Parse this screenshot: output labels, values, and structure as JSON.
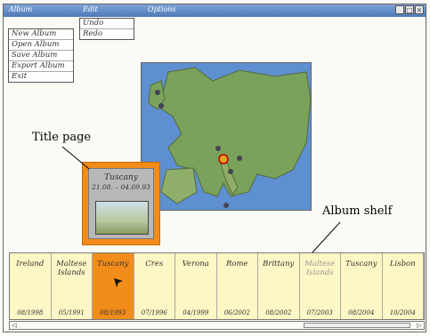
{
  "menu": {
    "album": "Album",
    "edit": "Edit",
    "options": "Options"
  },
  "window_buttons": [
    "_",
    "□",
    "×"
  ],
  "album_menu_items": [
    "New Album",
    "Open Album",
    "Save Album",
    "Export Album",
    "Exit"
  ],
  "edit_menu_items": [
    "Undo",
    "Redo"
  ],
  "title_page": {
    "title": "Tuscany",
    "dates": "21.08. – 04.09.93"
  },
  "callouts": {
    "title_page": "Title page",
    "album_shelf": "Album shelf"
  },
  "albums": [
    {
      "name": "Ireland",
      "date": "08/1998"
    },
    {
      "name": "Maltese Islands",
      "date": "05/1991"
    },
    {
      "name": "Tuscany",
      "date": "08/1993"
    },
    {
      "name": "Cres",
      "date": "07/1996"
    },
    {
      "name": "Verona",
      "date": "04/1999"
    },
    {
      "name": "Rome",
      "date": "06/2002"
    },
    {
      "name": "Brittany",
      "date": "08/2002"
    },
    {
      "name": "Maltese Islands",
      "date": "07/2003"
    },
    {
      "name": "Tuscany",
      "date": "08/2004"
    },
    {
      "name": "Lisbon",
      "date": "10/2004"
    }
  ],
  "selected_album_index": 2,
  "faded_album_index": 7,
  "colors": {
    "selected": "#f28c1a",
    "shelf": "#fdf6c5",
    "sea": "#5d8fd1",
    "land": "#7aa25a",
    "titlebar": "#4f79b7"
  },
  "icons": {
    "cursor": "arrow-cursor-icon",
    "map_pin": "map-pin-icon",
    "scroll_left": "◁",
    "scroll_right": "▷"
  }
}
